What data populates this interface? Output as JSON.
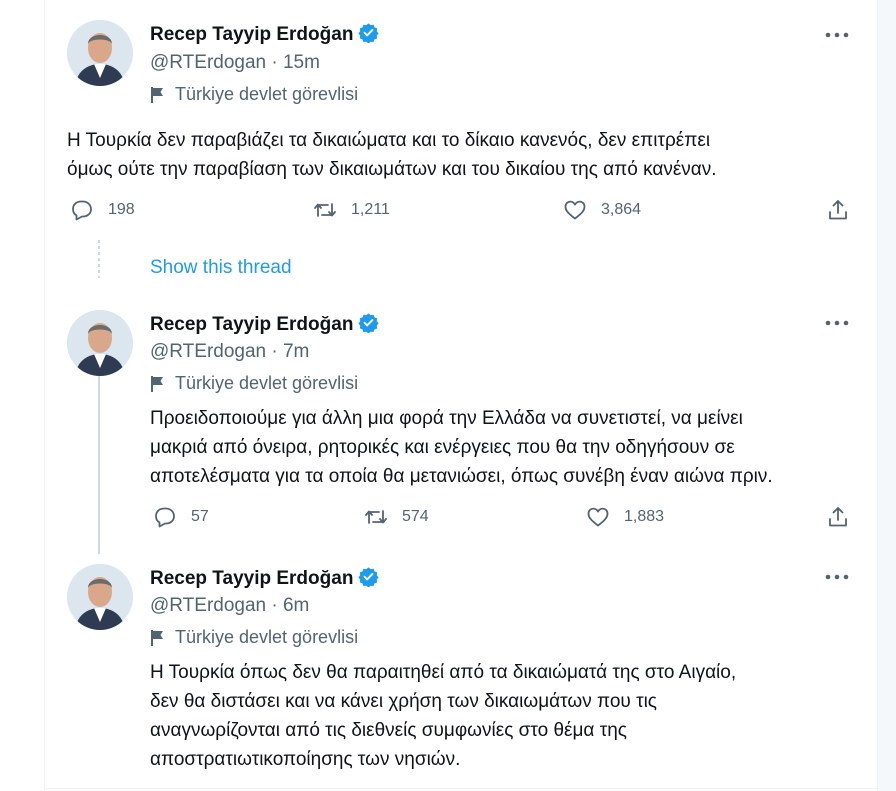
{
  "colors": {
    "accent": "#1d9bf0",
    "text": "#0f1419",
    "muted": "#536471"
  },
  "thread_link": "Show this thread",
  "tweets": [
    {
      "name": "Recep Tayyip Erdoğan",
      "handle": "@RTErdogan · 15m",
      "label": "Türkiye devlet görevlisi",
      "lines": [
        "Η Τουρκία δεν παραβιάζει  τα δικαιώματα και το δίκαιο κανενός, δεν επιτρέπει",
        "όμως ούτε την παραβίαση των δικαιωμάτων και του δικαίου της από κανέναν."
      ],
      "replies": "198",
      "retweets": "1,211",
      "likes": "3,864"
    },
    {
      "name": "Recep Tayyip Erdoğan",
      "handle": "@RTErdogan · 7m",
      "label": "Türkiye devlet görevlisi",
      "lines": [
        "Προειδοποιούμε για άλλη μια φορά την Ελλάδα να συνετιστεί, να μείνει",
        "μακριά από όνειρα, ρητορικές και ενέργειες που θα την οδηγήσουν σε",
        "αποτελέσματα για τα οποία θα μετανιώσει, όπως συνέβη έναν αιώνα πριν."
      ],
      "replies": "57",
      "retweets": "574",
      "likes": "1,883"
    },
    {
      "name": "Recep Tayyip Erdoğan",
      "handle": "@RTErdogan · 6m",
      "label": "Türkiye devlet görevlisi",
      "lines": [
        "Η Τουρκία όπως δεν θα παραιτηθεί από τα δικαιώματά της στο Αιγαίο,",
        "δεν θα διστάσει και να κάνει χρήση των δικαιωμάτων  που τις",
        "αναγνωρίζονται από τις διεθνείς συμφωνίες στο θέμα της",
        "αποστρατιωτικοποίησης των νησιών."
      ]
    }
  ],
  "icons": {
    "verified": "verified-badge-icon",
    "flag": "flag-icon",
    "more": "more-options-icon",
    "reply": "reply-icon",
    "retweet": "retweet-icon",
    "like": "like-icon",
    "share": "share-icon"
  }
}
